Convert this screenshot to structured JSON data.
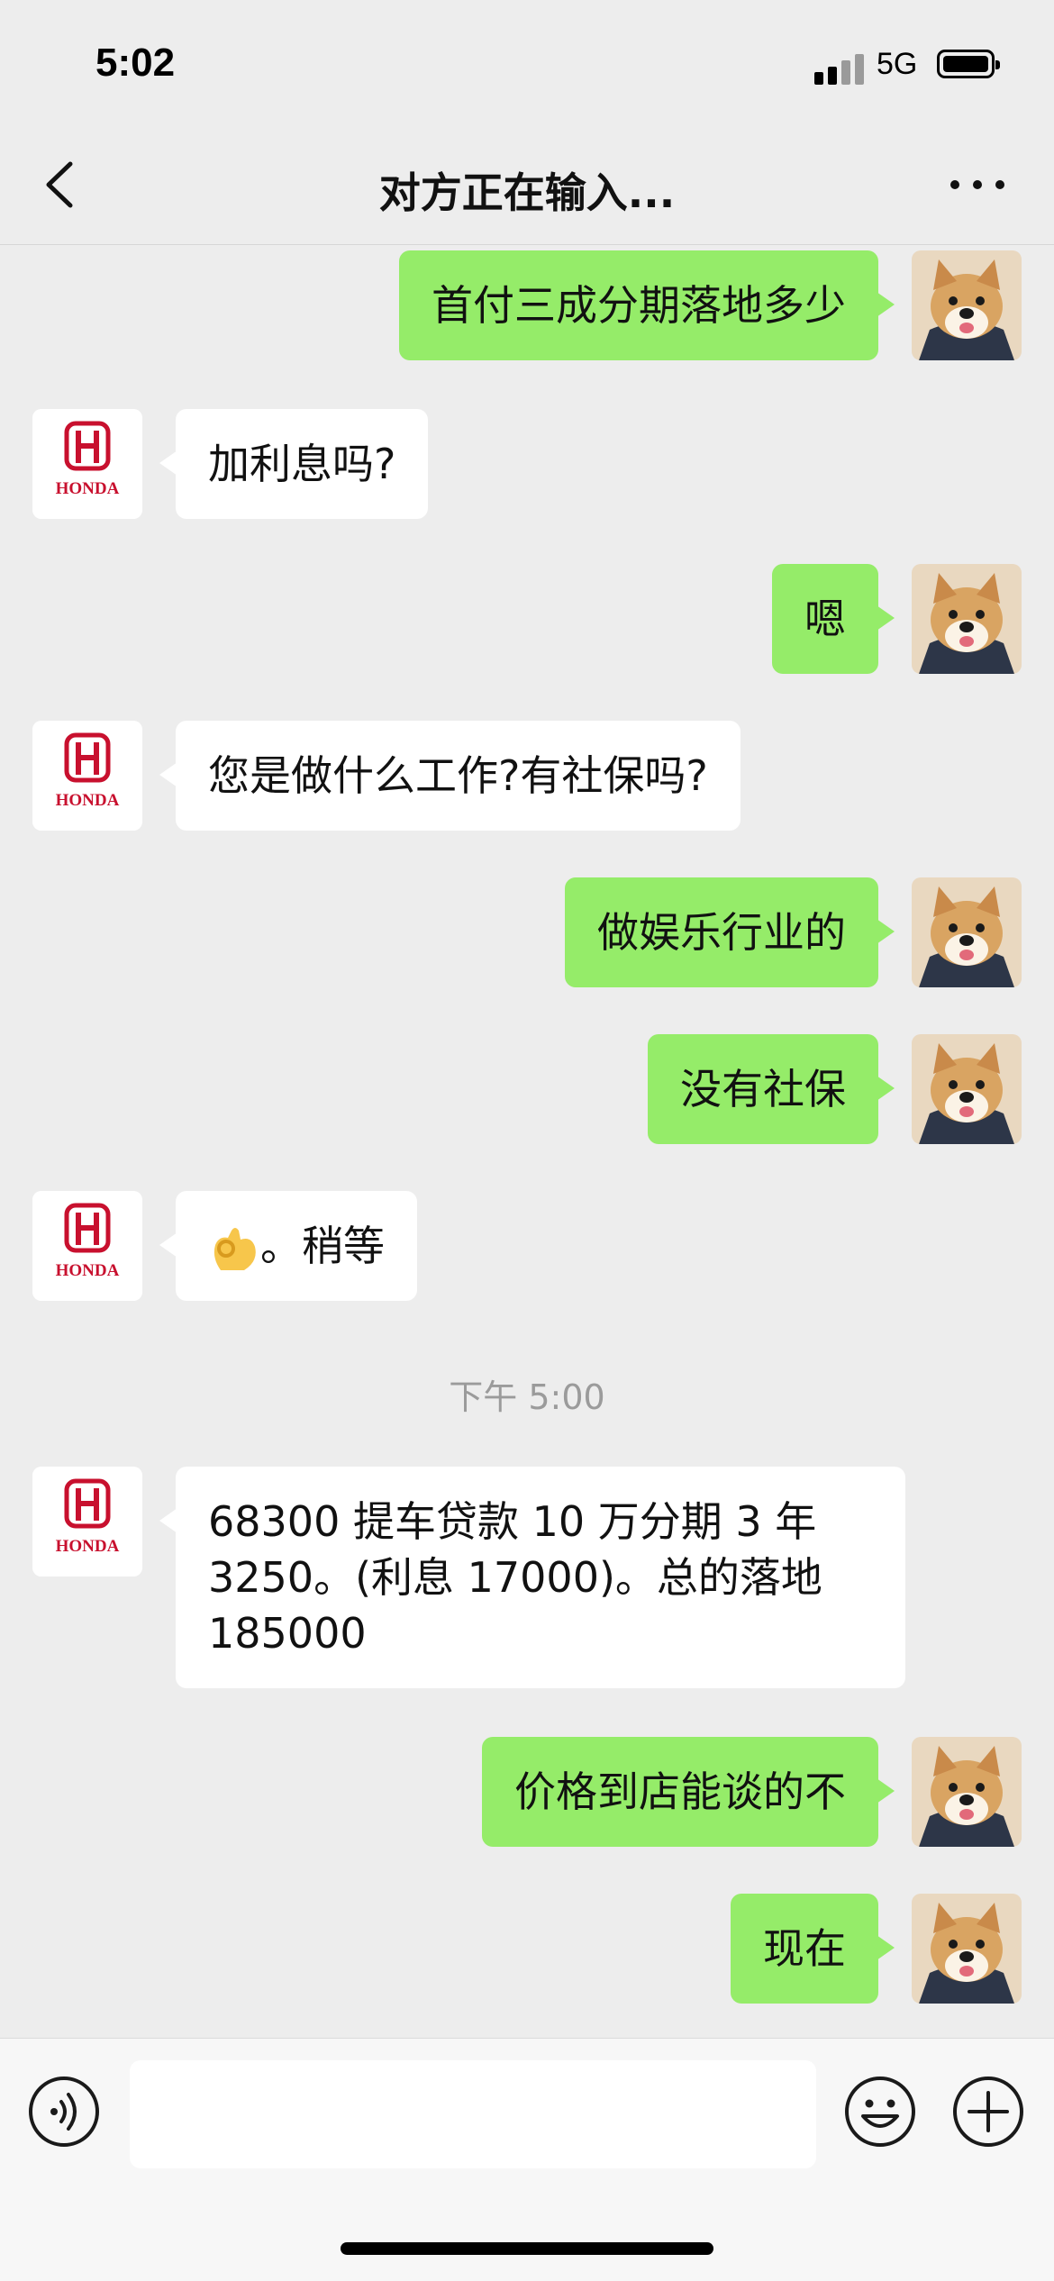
{
  "status_bar": {
    "time": "5:02",
    "network": "5G"
  },
  "header": {
    "title": "对方正在输入..."
  },
  "messages": [
    {
      "side": "out",
      "text": "首付三成分期落地多少"
    },
    {
      "side": "in",
      "text": "加利息吗?"
    },
    {
      "side": "out",
      "text": "嗯"
    },
    {
      "side": "in",
      "text": "您是做什么工作?有社保吗?"
    },
    {
      "side": "out",
      "text": "做娱乐行业的"
    },
    {
      "side": "out",
      "text": "没有社保"
    },
    {
      "side": "in",
      "emoji": "ok-hand",
      "text": "。稍等"
    },
    {
      "timestamp": "下午 5:00"
    },
    {
      "side": "in",
      "text": "68300 提车贷款 10 万分期 3 年 3250。(利息 17000)。总的落地 185000"
    },
    {
      "side": "out",
      "text": "价格到店能谈的不"
    },
    {
      "side": "out",
      "text": "现在"
    }
  ],
  "contact_avatar": {
    "brand": "HONDA",
    "color": "#c8102e"
  },
  "user_avatar": {
    "name": "shiba-dog-avatar"
  },
  "colors": {
    "background": "#ededed",
    "outgoing_bubble": "#95ec69",
    "incoming_bubble": "#ffffff"
  },
  "input_bar": {
    "icons": [
      "voice-icon",
      "emoji-icon",
      "plus-icon"
    ]
  }
}
